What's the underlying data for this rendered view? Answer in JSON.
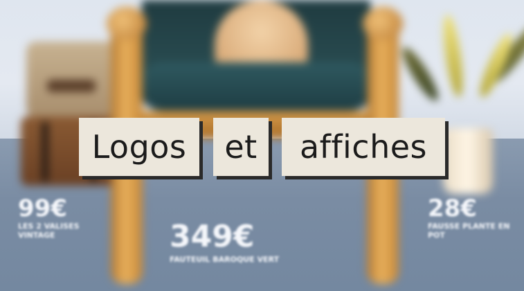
{
  "title_words": [
    "Logos",
    "et",
    "affiches"
  ],
  "prices": [
    {
      "amount": "99€",
      "label": "LES 2 VALISES VINTAGE"
    },
    {
      "amount": "349€",
      "label": "FAUTEUIL BAROQUE VERT"
    },
    {
      "amount": "28€",
      "label": "FAUSSE PLANTE EN POT"
    }
  ],
  "colors": {
    "chip_bg": "#ece7dc",
    "chip_shadow": "#2a2a2a",
    "title_text": "#1b1b1b",
    "wall": "#dfe6ef",
    "floor": "#7a8ca3"
  }
}
